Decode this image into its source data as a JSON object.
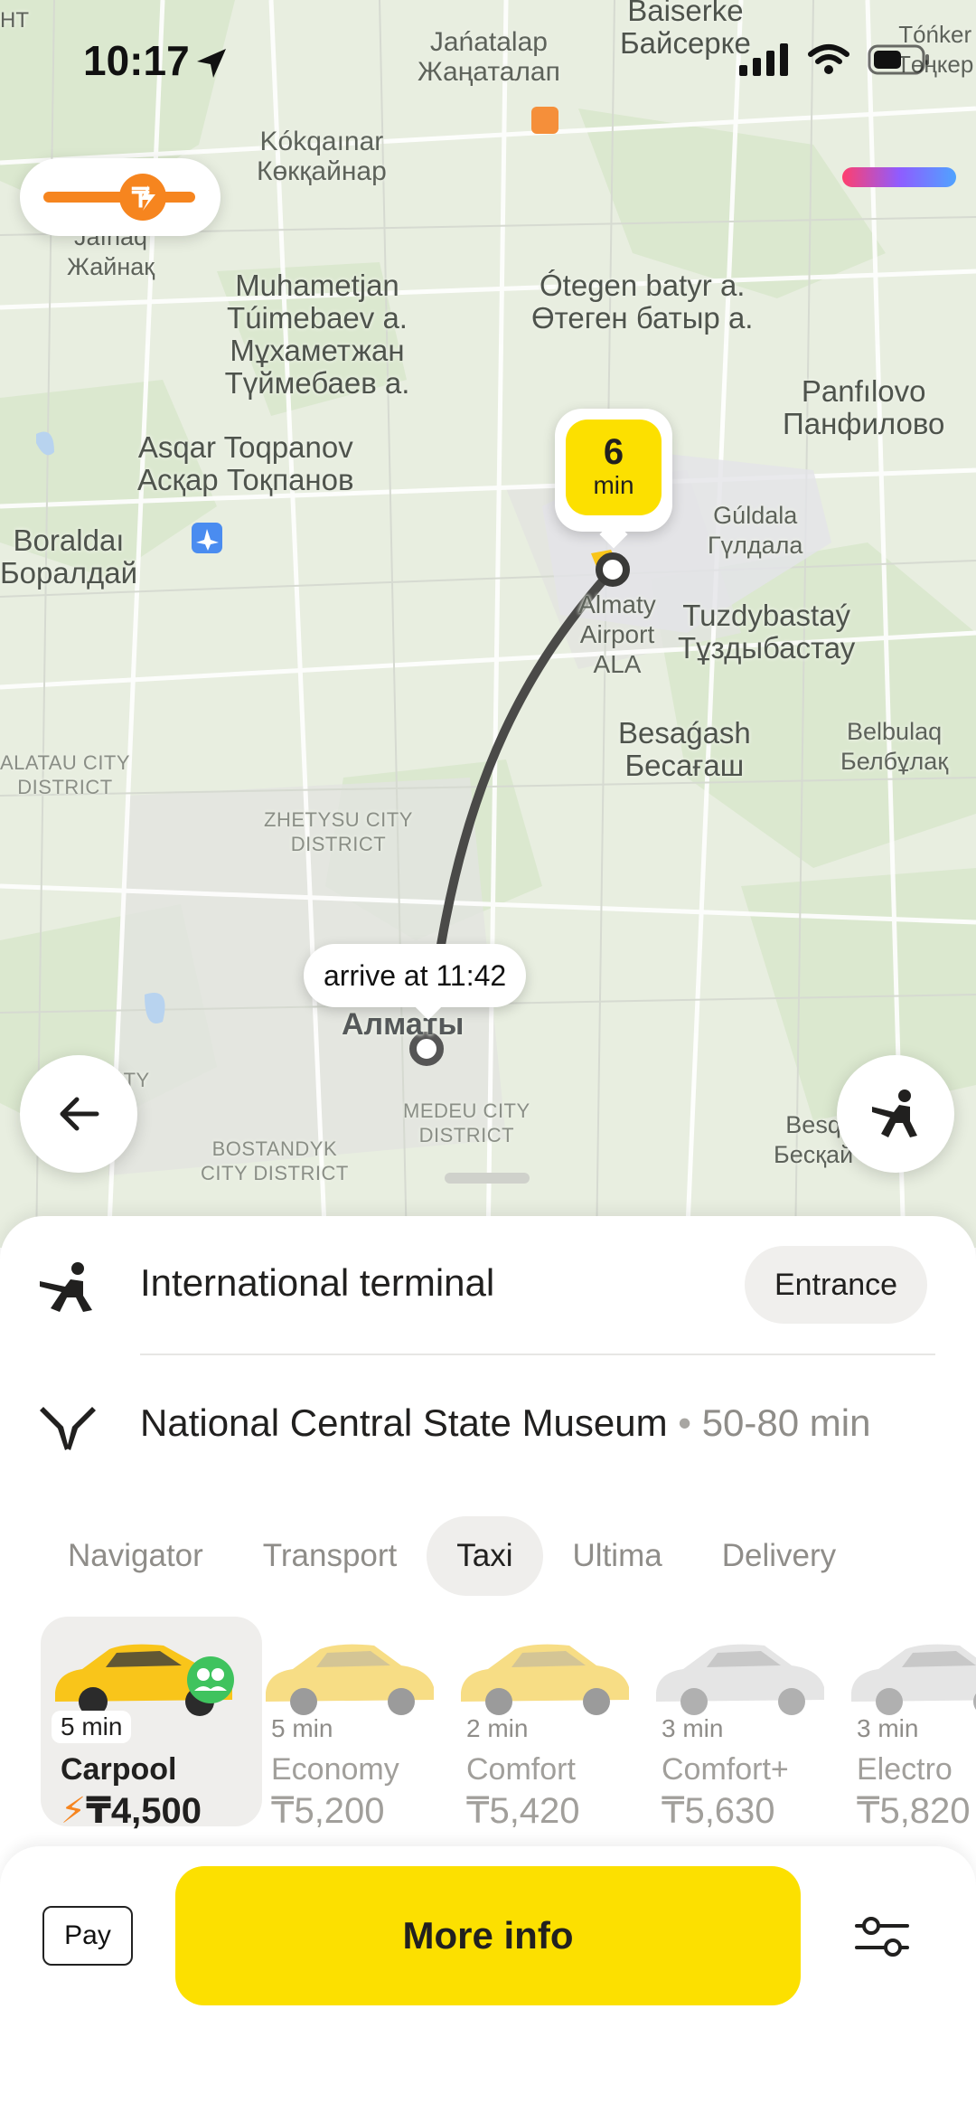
{
  "status_bar": {
    "time": "10:17"
  },
  "map": {
    "labels": [
      {
        "id": "zhanatalap",
        "latin": "Jańatalap",
        "cyr": "Жаңаталап"
      },
      {
        "id": "baiserke",
        "latin": "Baiserke",
        "cyr": "Байсерке"
      },
      {
        "id": "tonker",
        "latin": "Tóńker",
        "cyr": "Төңкер"
      },
      {
        "id": "kokqainar",
        "latin": "Kókqaınar",
        "cyr": "Көкқайнар"
      },
      {
        "id": "zhainaq",
        "latin": "Jaınaq",
        "cyr": "Жайнақ"
      },
      {
        "id": "muhametjan",
        "latin": "Muhametjan Túimebaev a.",
        "cyr": "Мұхаметжан Түймебаев а."
      },
      {
        "id": "otegen",
        "latin": "Ótegen batyr a.",
        "cyr": "Өтеген батыр а."
      },
      {
        "id": "panfilovo",
        "latin": "Panfılovo",
        "cyr": "Панфилово"
      },
      {
        "id": "asqar",
        "latin": "Asqar Toqpanov",
        "cyr": "Асқар Тоқпанов"
      },
      {
        "id": "boraldai",
        "latin": "Boraldaı",
        "cyr": "Боралдай"
      },
      {
        "id": "guldala",
        "latin": "Gúldala",
        "cyr": "Гүлдала"
      },
      {
        "id": "airport",
        "latin": "Almaty Airport",
        "cyr": "ALA"
      },
      {
        "id": "tuzdybastau",
        "latin": "Tuzdybastaý",
        "cyr": "Тұздыбастау"
      },
      {
        "id": "besagash",
        "latin": "Besaǵash",
        "cyr": "Бесағаш"
      },
      {
        "id": "belbulaq",
        "latin": "Belbulaq",
        "cyr": "Белбұлақ"
      },
      {
        "id": "alatau",
        "latin": "ALATAU CITY",
        "cyr": "DISTRICT"
      },
      {
        "id": "zhetysu",
        "latin": "ZHETYSU CITY",
        "cyr": "DISTRICT"
      },
      {
        "id": "almaty",
        "latin": "Алматы",
        "cyr": ""
      },
      {
        "id": "medeu",
        "latin": "MEDEU CITY",
        "cyr": "DISTRICT"
      },
      {
        "id": "bostandyk",
        "latin": "BOSTANDYK",
        "cyr": "CITY DISTRICT"
      },
      {
        "id": "auezov",
        "latin": "ITY",
        "cyr": ""
      },
      {
        "id": "besqainar",
        "latin": "Besq",
        "cyr": "Бесқай"
      },
      {
        "id": "nt",
        "latin": "НТ",
        "cyr": ""
      }
    ],
    "eta_pin": {
      "value": "6",
      "unit": "min"
    },
    "arrive_bubble": "arrive at 11:42",
    "accent_colors": {
      "route": "#4a4a48",
      "pin": "#fce000",
      "traffic": "#f6851f"
    }
  },
  "route": {
    "from": "International terminal",
    "entrance_label": "Entrance",
    "to": "National Central State Museum",
    "separator": "•",
    "duration": "50-80 min"
  },
  "service_tabs": [
    {
      "label": "Navigator",
      "active": false
    },
    {
      "label": "Transport",
      "active": false
    },
    {
      "label": "Taxi",
      "active": true
    },
    {
      "label": "Ultima",
      "active": false
    },
    {
      "label": "Delivery",
      "active": false
    }
  ],
  "tariffs": [
    {
      "eta": "5 min",
      "name": "Carpool",
      "price": "₸4,500",
      "selected": true,
      "car_color": "#f9c51a"
    },
    {
      "eta": "5 min",
      "name": "Economy",
      "price": "₸5,200",
      "selected": false,
      "car_color": "#f7dd85"
    },
    {
      "eta": "2 min",
      "name": "Comfort",
      "price": "₸5,420",
      "selected": false,
      "car_color": "#f7dd85"
    },
    {
      "eta": "3 min",
      "name": "Comfort+",
      "price": "₸5,630",
      "selected": false,
      "car_color": "#e3e3e3"
    },
    {
      "eta": "3 min",
      "name": "Electro",
      "price": "₸5,820",
      "selected": false,
      "car_color": "#e3e3e3"
    }
  ],
  "bottom_bar": {
    "payment_label": "Pay",
    "cta_label": "More info"
  }
}
